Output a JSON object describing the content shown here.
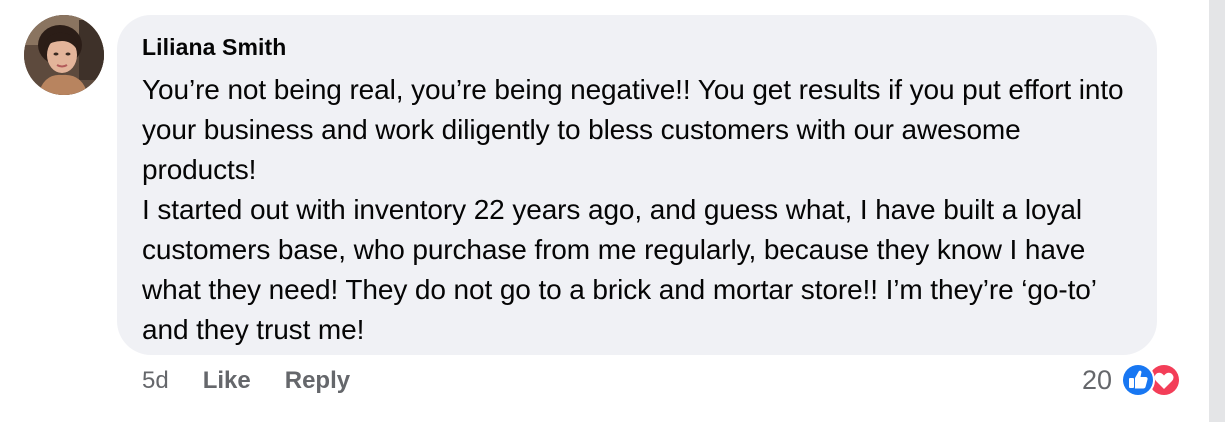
{
  "comment": {
    "author": "Liliana Smith",
    "paragraphs": [
      "You’re not being real, you’re being negative!! You get results if you put effort into your business and work diligently to bless customers with our awesome products!",
      "I started out with inventory 22 years ago, and guess what, I have built a loyal customers base, who purchase from me regularly, because they know I have what they need! They do not go to a brick and mortar store!! I’m they’re ‘go-to’ and they trust me!"
    ]
  },
  "actions": {
    "timestamp": "5d",
    "like_label": "Like",
    "reply_label": "Reply"
  },
  "reactions": {
    "count": "20",
    "icons": [
      "like-icon",
      "love-icon"
    ],
    "like_color": "#1877f2",
    "love_color": "#f33e58"
  },
  "colors": {
    "bubble_bg": "#f0f1f5",
    "secondary_text": "#65676b",
    "primary_text": "#050505"
  }
}
